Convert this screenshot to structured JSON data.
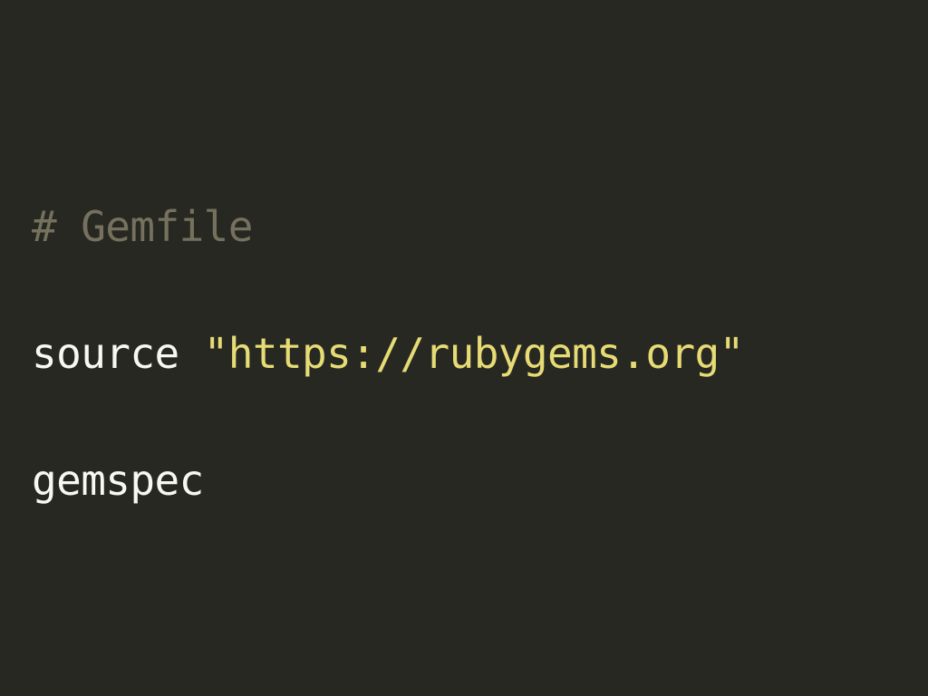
{
  "code": {
    "lines": [
      {
        "tokens": [
          {
            "type": "comment",
            "text": "# Gemfile"
          }
        ]
      },
      {
        "tokens": [
          {
            "type": "plain",
            "text": "source "
          },
          {
            "type": "string",
            "text": "\"https://rubygems.org\""
          }
        ]
      },
      {
        "tokens": [
          {
            "type": "plain",
            "text": "gemspec"
          }
        ]
      }
    ]
  },
  "colors": {
    "background": "#272822",
    "comment": "#75715e",
    "plain": "#f8f8f2",
    "string": "#e6db74"
  }
}
